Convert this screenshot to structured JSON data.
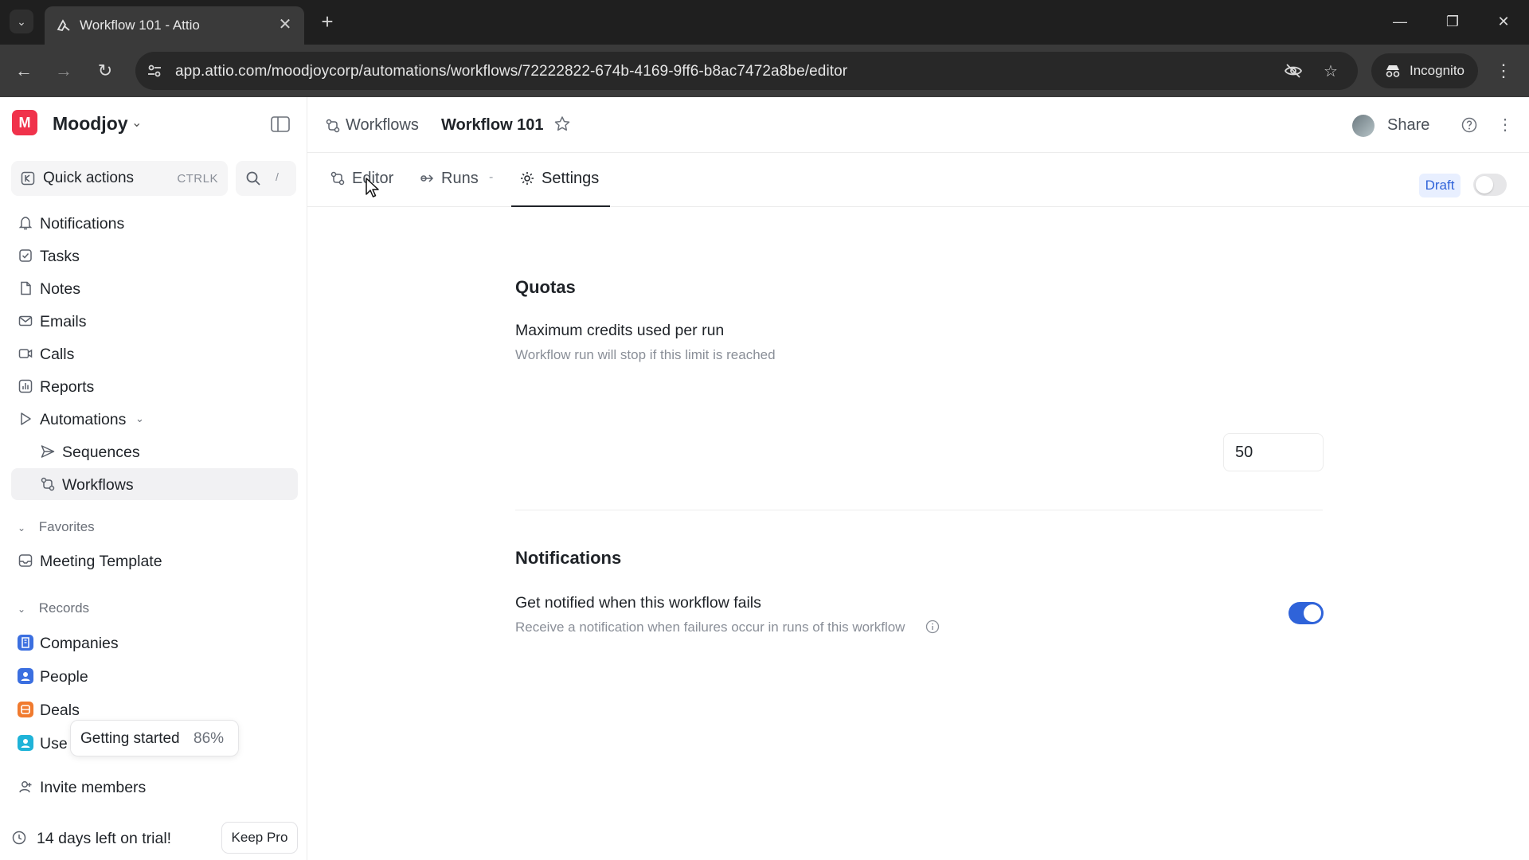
{
  "browser": {
    "tab_title": "Workflow 101 - Attio",
    "url": "app.attio.com/moodjoycorp/automations/workflows/72222822-674b-4169-9ff6-b8ac7472a8be/editor",
    "incognito_label": "Incognito"
  },
  "workspace": {
    "initial": "M",
    "name": "Moodjoy"
  },
  "quick_actions": {
    "label": "Quick actions",
    "shortcut": "CTRLK",
    "search_key": "/"
  },
  "sidebar": {
    "nav": [
      {
        "label": "Notifications",
        "icon": "bell-icon"
      },
      {
        "label": "Tasks",
        "icon": "checkbox-icon"
      },
      {
        "label": "Notes",
        "icon": "note-icon"
      },
      {
        "label": "Emails",
        "icon": "mail-icon"
      },
      {
        "label": "Calls",
        "icon": "video-icon"
      },
      {
        "label": "Reports",
        "icon": "chart-icon"
      },
      {
        "label": "Automations",
        "icon": "play-icon"
      },
      {
        "label": "Sequences",
        "icon": "send-icon"
      },
      {
        "label": "Workflows",
        "icon": "workflow-icon"
      }
    ],
    "favorites_label": "Favorites",
    "favorites": [
      {
        "label": "Meeting Template"
      }
    ],
    "records_label": "Records",
    "records": [
      {
        "label": "Companies",
        "color": "#3b6fe0"
      },
      {
        "label": "People",
        "color": "#3b6fe0"
      },
      {
        "label": "Deals",
        "color": "#f07a2e"
      },
      {
        "label": "Use",
        "color": "#1fb3d8"
      }
    ],
    "getting_started": {
      "label": "Getting started",
      "percent": "86%"
    },
    "invite_label": "Invite members",
    "trial_label": "14 days left on trial!",
    "keep_label": "Keep Pro"
  },
  "header": {
    "breadcrumb_parent": "Workflows",
    "title": "Workflow 101",
    "share_label": "Share"
  },
  "tabs": [
    {
      "label": "Editor"
    },
    {
      "label": "Runs"
    },
    {
      "label": "Settings"
    }
  ],
  "status": {
    "draft_label": "Draft",
    "published": false
  },
  "settings": {
    "quotas_heading": "Quotas",
    "max_credits_title": "Maximum credits used per run",
    "max_credits_desc": "Workflow run will stop if this limit is reached",
    "max_credits_value": "50",
    "notifications_heading": "Notifications",
    "notify_title": "Get notified when this workflow fails",
    "notify_desc": "Receive a notification when failures occur in runs of this workflow",
    "notify_enabled": true
  }
}
